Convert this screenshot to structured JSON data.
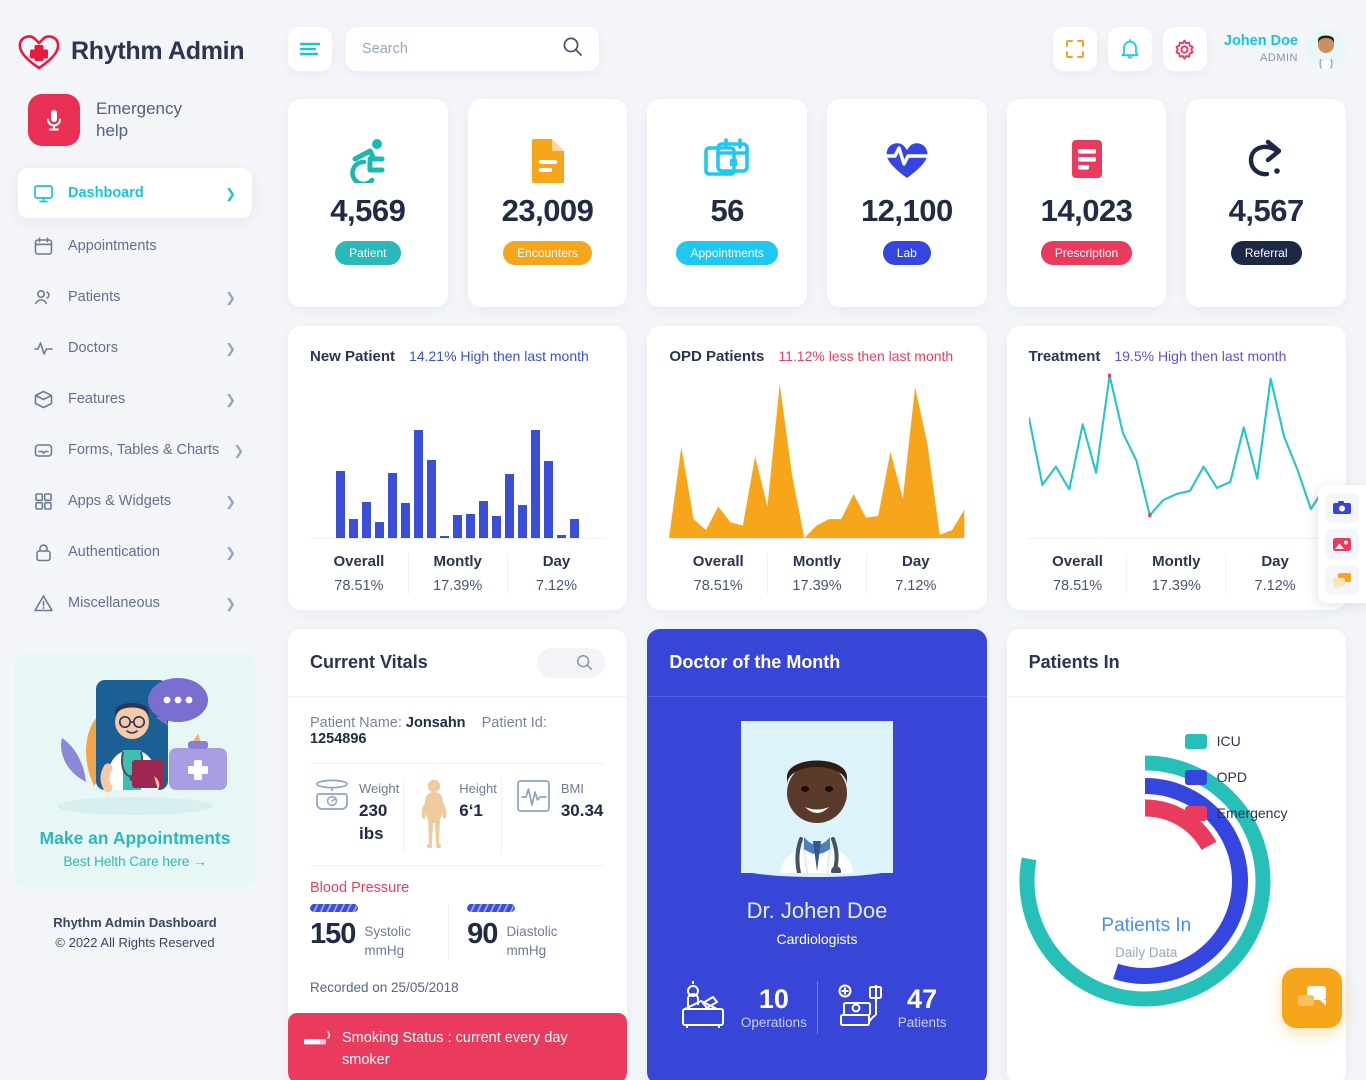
{
  "brand": {
    "name": "Rhythm Admin",
    "logo_icon": "heart-cross-logo"
  },
  "topbar": {
    "menu_icon": "hamburger-icon",
    "search": {
      "placeholder": "Search",
      "value": "",
      "icon": "search-icon"
    },
    "fullscreen_icon": "fullscreen-icon",
    "bell_icon": "bell-icon",
    "gear_icon": "gear-icon",
    "user": {
      "name": "Johen Doe",
      "role": "ADMIN",
      "avatar_icon": "doctor-avatar"
    }
  },
  "sidebar": {
    "emergency": {
      "label": "Emergency help",
      "icon": "microphone-icon"
    },
    "items": [
      {
        "label": "Dashboard",
        "icon": "monitor-icon",
        "active": true,
        "caret": true
      },
      {
        "label": "Appointments",
        "icon": "calendar-icon",
        "active": false,
        "caret": false
      },
      {
        "label": "Patients",
        "icon": "users-icon",
        "active": false,
        "caret": true
      },
      {
        "label": "Doctors",
        "icon": "pulse-icon",
        "active": false,
        "caret": true
      },
      {
        "label": "Features",
        "icon": "box-icon",
        "active": false,
        "caret": true
      },
      {
        "label": "Forms, Tables & Charts",
        "icon": "inbox-icon",
        "active": false,
        "caret": true
      },
      {
        "label": "Apps & Widgets",
        "icon": "grid-icon",
        "active": false,
        "caret": true
      },
      {
        "label": "Authentication",
        "icon": "lock-icon",
        "active": false,
        "caret": true
      },
      {
        "label": "Miscellaneous",
        "icon": "warning-icon",
        "active": false,
        "caret": true
      }
    ],
    "promo": {
      "title": "Make an Appointments",
      "subtitle": "Best Helth Care here →",
      "art_icon": "doctor-illustration"
    },
    "footer": {
      "line1": "Rhythm Admin Dashboard",
      "line2": "© 2022 All Rights Reserved"
    }
  },
  "stats": [
    {
      "value": "4,569",
      "badge": "Patient",
      "badge_color": "#2ab8b8",
      "icon": "wheelchair-icon",
      "icon_color": "#1ab8b0"
    },
    {
      "value": "23,009",
      "badge": "Encounters",
      "badge_color": "#f7a51b",
      "icon": "document-icon",
      "icon_color": "#f7a51b"
    },
    {
      "value": "56",
      "badge": "Appointments",
      "badge_color": "#1ec8f0",
      "icon": "calendar-add-icon",
      "icon_color": "#1ec8f0"
    },
    {
      "value": "12,100",
      "badge": "Lab",
      "badge_color": "#3546e0",
      "icon": "heart-pulse-icon",
      "icon_color": "#3546e0"
    },
    {
      "value": "14,023",
      "badge": "Prescription",
      "badge_color": "#ea3a5e",
      "icon": "prescription-icon",
      "icon_color": "#ea3a5e"
    },
    {
      "value": "4,567",
      "badge": "Referral",
      "badge_color": "#1d2746",
      "icon": "referral-icon",
      "icon_color": "#1d2746"
    }
  ],
  "chart_data": [
    {
      "type": "bar",
      "title": "New Patient",
      "delta": "14.21% High then last month",
      "delta_color": "#3b4ed6",
      "series_color": "#3b4ed6",
      "values": [
        62,
        18,
        33,
        15,
        60,
        32,
        100,
        72,
        2,
        21,
        22,
        34,
        20,
        59,
        31,
        100,
        71,
        3,
        18
      ],
      "ylim": [
        0,
        100
      ],
      "grid": false,
      "footer": [
        {
          "label": "Overall",
          "value": "78.51%"
        },
        {
          "label": "Montly",
          "value": "17.39%"
        },
        {
          "label": "Day",
          "value": "7.12%"
        }
      ]
    },
    {
      "type": "area",
      "title": "OPD Patients",
      "delta": "11.12% less then last month",
      "delta_color": "#ea4060",
      "series_color": "#f7a51b",
      "values": [
        0,
        58,
        12,
        5,
        20,
        10,
        8,
        52,
        20,
        98,
        40,
        0,
        8,
        12,
        12,
        28,
        13,
        14,
        55,
        25,
        96,
        60,
        2,
        5,
        18
      ],
      "ylim": [
        0,
        100
      ],
      "grid": false,
      "footer": [
        {
          "label": "Overall",
          "value": "78.51%"
        },
        {
          "label": "Montly",
          "value": "17.39%"
        },
        {
          "label": "Day",
          "value": "7.12%"
        }
      ]
    },
    {
      "type": "line",
      "title": "Treatment",
      "delta": "19.5% High then last month",
      "delta_color": "#5b52d8",
      "series_color": "#26c6c6",
      "marker_color": "#ea3a5e",
      "values": [
        72,
        28,
        40,
        25,
        68,
        36,
        100,
        62,
        44,
        8,
        18,
        22,
        24,
        40,
        26,
        30,
        66,
        32,
        98,
        60,
        38,
        12,
        26
      ],
      "ylim": [
        0,
        100
      ],
      "grid": false,
      "footer": [
        {
          "label": "Overall",
          "value": "78.51%"
        },
        {
          "label": "Montly",
          "value": "17.39%"
        },
        {
          "label": "Day",
          "value": "7.12%"
        }
      ]
    },
    {
      "type": "pie",
      "title": "Patients In",
      "center_label": "Patients In",
      "center_sub": "Daily Data",
      "legend_position": "right",
      "categories": [
        "ICU",
        "OPD",
        "Emergency"
      ],
      "values": [
        78,
        55,
        17
      ],
      "colors": [
        "#26c0b8",
        "#3546e0",
        "#ea3a5e"
      ]
    }
  ],
  "vitals": {
    "title": "Current Vitals",
    "search_icon": "search-icon",
    "patient_name_label": "Patient Name:",
    "patient_name": "Jonsahn",
    "patient_id_label": "Patient Id:",
    "patient_id": "1254896",
    "metrics": [
      {
        "label": "Weight",
        "value": "230",
        "unit": "ibs",
        "icon": "scale-icon"
      },
      {
        "label": "Height",
        "value": "6‘1",
        "unit": "",
        "icon": "body-icon"
      },
      {
        "label": "BMI",
        "value": "30.34",
        "unit": "",
        "icon": "ecg-icon"
      }
    ],
    "bp_title": "Blood Pressure",
    "bp": [
      {
        "value": "150",
        "label": "Systolic",
        "unit": "mmHg"
      },
      {
        "value": "90",
        "label": "Diastolic",
        "unit": "mmHg"
      }
    ],
    "recorded": "Recorded on 25/05/2018",
    "smoking": "Smoking Status : current every day smoker",
    "smoking_icon": "cigarette-icon"
  },
  "doctor": {
    "title": "Doctor of the Month",
    "name": "Dr. Johen Doe",
    "specialty": "Cardiologists",
    "photo_icon": "doctor-photo",
    "stats": [
      {
        "value": "10",
        "label": "Operations",
        "icon": "surgery-icon"
      },
      {
        "value": "47",
        "label": "Patients",
        "icon": "patient-bed-icon"
      }
    ]
  },
  "float_tools": [
    {
      "icon": "camera-icon",
      "color": "#3546e0"
    },
    {
      "icon": "image-icon",
      "color": "#ea3a5e"
    },
    {
      "icon": "chat-icon",
      "color": "#f7a51b"
    }
  ],
  "chat_fab": {
    "icon": "chat-bubble-icon",
    "color": "#f7a51b"
  }
}
